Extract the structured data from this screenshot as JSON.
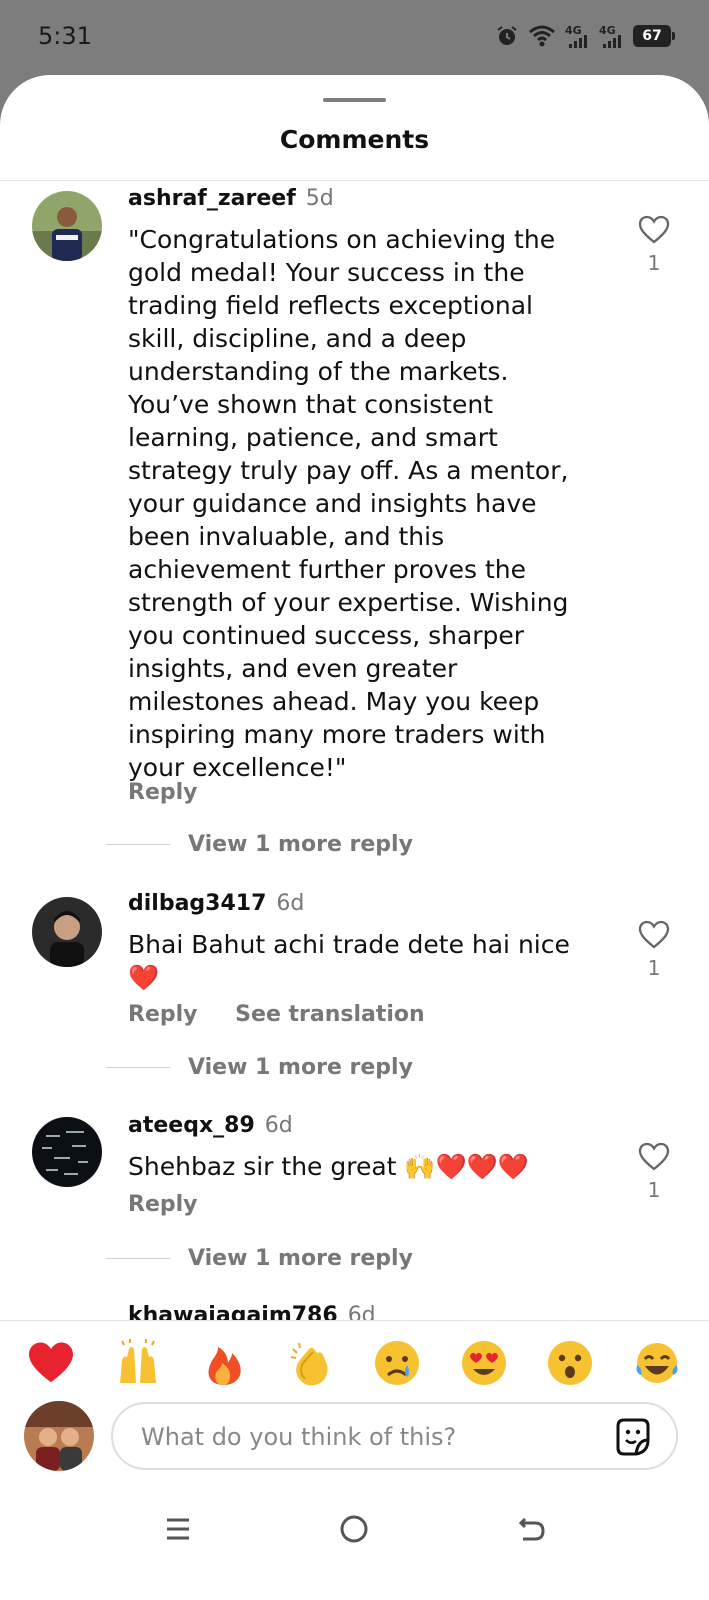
{
  "status_bar": {
    "time": "5:31",
    "net1_label": "4G",
    "net2_label": "4G",
    "battery": "67"
  },
  "sheet": {
    "title": "Comments"
  },
  "comments": [
    {
      "username": "ashraf_zareef",
      "time": "5d",
      "text": "\"Congratulations on achieving the gold medal! Your success in the trading field reflects exceptional skill, discipline, and a deep understanding of the markets. You’ve shown that consistent learning, patience, and smart strategy truly pay off. As a mentor, your guidance and insights have been invaluable, and this achievement further proves the strength of your expertise. Wishing you continued success, sharper insights, and even greater milestones ahead. May you keep inspiring many more traders with your excellence!\"",
      "reply_label": "Reply",
      "likes": "1",
      "more_replies": "View 1 more reply"
    },
    {
      "username": "dilbag3417",
      "time": "6d",
      "text": "Bhai Bahut achi trade dete hai nice ❤️",
      "reply_label": "Reply",
      "translate_label": "See translation",
      "likes": "1",
      "more_replies": "View 1 more reply"
    },
    {
      "username": "ateeqx_89",
      "time": "6d",
      "text": "Shehbaz sir the great 🙌❤️❤️❤️",
      "reply_label": "Reply",
      "likes": "1",
      "more_replies": "View 1 more reply"
    },
    {
      "username": "khawajaqaim786",
      "time": "6d"
    }
  ],
  "quick_reactions": [
    "heart",
    "raised-hands",
    "fire",
    "clapping-hands",
    "crying-face",
    "heart-eyes-face",
    "surprised-face",
    "tears-of-joy-face"
  ],
  "composer": {
    "placeholder": "What do you think of this?"
  },
  "colors": {
    "accent_heart": "#e8232f",
    "text_primary": "#111111",
    "text_secondary": "#777777",
    "overlay": "#7d7d7d"
  }
}
